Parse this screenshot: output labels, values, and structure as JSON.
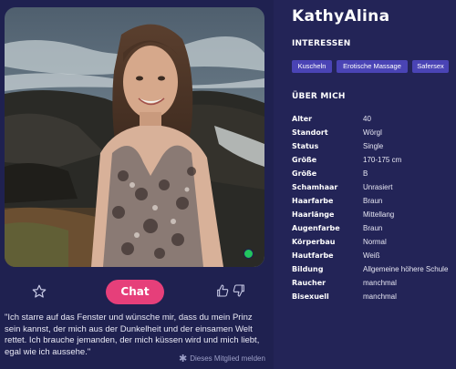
{
  "profile": {
    "name": "KathyAlina",
    "online": true
  },
  "interests": {
    "title": "INTERESSEN",
    "tags": [
      "Kuscheln",
      "Erotische Massage",
      "Safersex"
    ]
  },
  "about": {
    "title": "ÜBER MICH",
    "rows": [
      {
        "label": "Alter",
        "value": "40"
      },
      {
        "label": "Standort",
        "value": "Wörgl"
      },
      {
        "label": "Status",
        "value": "Single"
      },
      {
        "label": "Größe",
        "value": "170-175 cm"
      },
      {
        "label": "Größe",
        "value": "B"
      },
      {
        "label": "Schamhaar",
        "value": "Unrasiert"
      },
      {
        "label": "Haarfarbe",
        "value": "Braun"
      },
      {
        "label": "Haarlänge",
        "value": "Mittellang"
      },
      {
        "label": "Augenfarbe",
        "value": "Braun"
      },
      {
        "label": "Körperbau",
        "value": "Normal"
      },
      {
        "label": "Hautfarbe",
        "value": "Weiß"
      },
      {
        "label": "Bildung",
        "value": "Allgemeine höhere Schule"
      },
      {
        "label": "Raucher",
        "value": "manchmal"
      },
      {
        "label": "Bisexuell",
        "value": "manchmal"
      }
    ]
  },
  "actions": {
    "chat_label": "Chat",
    "report_label": "Dieses Mitglied melden"
  },
  "quote": {
    "text": "\"Ich starre auf das Fenster und wünsche mir, dass du mein Prinz sein kannst, der mich aus der Dunkelheit und der einsamen Welt rettet. Ich brauche jemanden, der mich küssen wird und mich liebt, egal wie ich aussehe.\""
  },
  "colors": {
    "background": "#1f2150",
    "panel": "#232457",
    "accent": "#e63f7a",
    "tag": "#4a44b5",
    "online": "#22c55e"
  }
}
